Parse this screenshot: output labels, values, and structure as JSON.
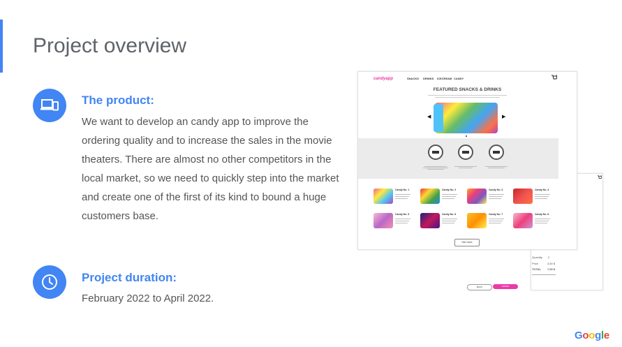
{
  "slide": {
    "title": "Project overview"
  },
  "product": {
    "heading": "The product:",
    "icon": "devices-icon",
    "lines": [
      "We want to develop an candy app to improve the",
      "ordering quality and to increase the sales in the movie",
      "theaters. There are almost no other competitors in the",
      "local market, so we need to quickly step into the market",
      "and create one of the first of its kind to bound a huge",
      "customers base."
    ]
  },
  "duration": {
    "heading": "Project duration:",
    "icon": "clock-icon",
    "text": "February 2022 to April 2022."
  },
  "mockup": {
    "logo": "candyapp",
    "nav": [
      "SNACKS",
      "DRINKS",
      "ICECREAM",
      "CANDY"
    ],
    "featured_title": "FEATURED SNACKS & DRINKS",
    "card_titles": [
      "Candy No. 1",
      "Candy No. 2",
      "Candy No. 3",
      "Candy No. 4",
      "Candy No. 5",
      "Candy No. 6",
      "Candy No. 7",
      "Candy No. 8"
    ],
    "see_more": "See more",
    "quantity_label": "Quantity",
    "quantity_value": "2",
    "price_label": "Price",
    "price_value": "3,50 $",
    "total_label": "TOTAL",
    "total_value": "7,00 $",
    "back_button": "BACK",
    "order_button": "ORDER"
  },
  "footer": {
    "brand": "Google"
  },
  "colors": {
    "accent": "#4285f4",
    "pink": "#ec3aa8"
  }
}
